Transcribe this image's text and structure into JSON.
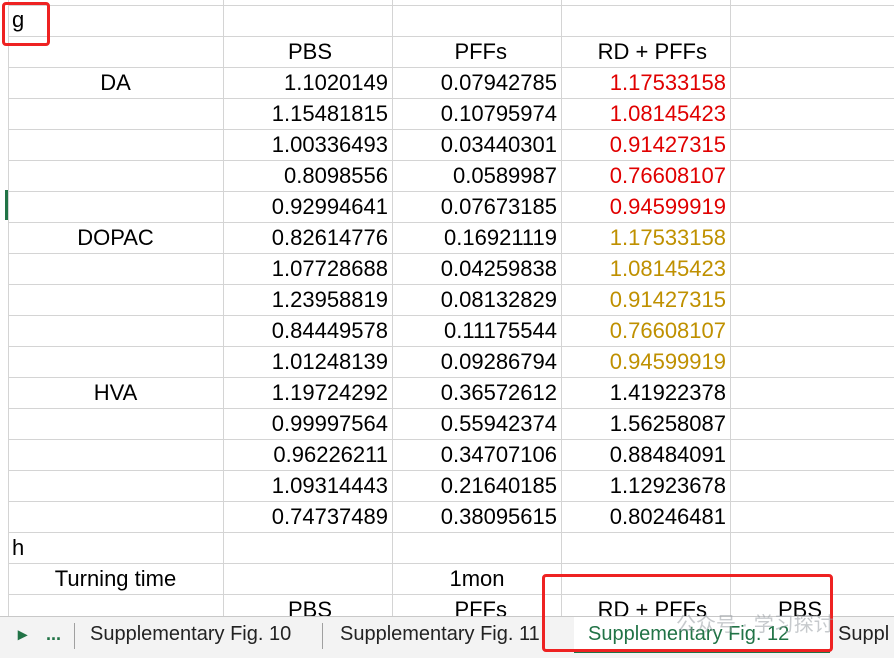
{
  "sheet": {
    "label_g": "g",
    "label_h": "h",
    "headers": [
      "PBS",
      "PFFs",
      "RD + PFFs"
    ],
    "groups": [
      {
        "name": "DA",
        "color": "#e00000"
      },
      {
        "name": "DOPAC",
        "color": "#bf9000"
      },
      {
        "name": "HVA",
        "color": "#000000"
      }
    ],
    "rows": [
      [
        "1.1020149",
        "0.07942785",
        "1.17533158"
      ],
      [
        "1.15481815",
        "0.10795974",
        "1.08145423"
      ],
      [
        "1.00336493",
        "0.03440301",
        "0.91427315"
      ],
      [
        "0.8098556",
        "0.0589987",
        "0.76608107"
      ],
      [
        "0.92994641",
        "0.07673185",
        "0.94599919"
      ],
      [
        "0.82614776",
        "0.16921119",
        "1.17533158"
      ],
      [
        "1.07728688",
        "0.04259838",
        "1.08145423"
      ],
      [
        "1.23958819",
        "0.08132829",
        "0.91427315"
      ],
      [
        "0.84449578",
        "0.11175544",
        "0.76608107"
      ],
      [
        "1.01248139",
        "0.09286794",
        "0.94599919"
      ],
      [
        "1.19724292",
        "0.36572612",
        "1.41922378"
      ],
      [
        "0.99997564",
        "0.55942374",
        "1.56258087"
      ],
      [
        "0.96226211",
        "0.34707106",
        "0.88484091"
      ],
      [
        "1.09314443",
        "0.21640185",
        "1.12923678"
      ],
      [
        "0.74737489",
        "0.38095615",
        "0.80246481"
      ]
    ],
    "turning_label": "Turning time",
    "turning_value": "1mon",
    "bottom_headers": [
      "PBS",
      "PFFs",
      "RD + PFFs",
      "PBS"
    ]
  },
  "tabs": {
    "nav_next": "▸",
    "nav_more": "...",
    "items": [
      {
        "label": "Supplementary Fig. 10"
      },
      {
        "label": "Supplementary Fig. 11"
      },
      {
        "label": "Supplementary Fig. 12"
      },
      {
        "label": "Suppl"
      }
    ]
  },
  "watermark": "公众号 · 学习探讨",
  "colors": {
    "accent": "#217346",
    "highlight": "#ee2222",
    "red_text": "#e00000",
    "gold_text": "#bf9000"
  }
}
